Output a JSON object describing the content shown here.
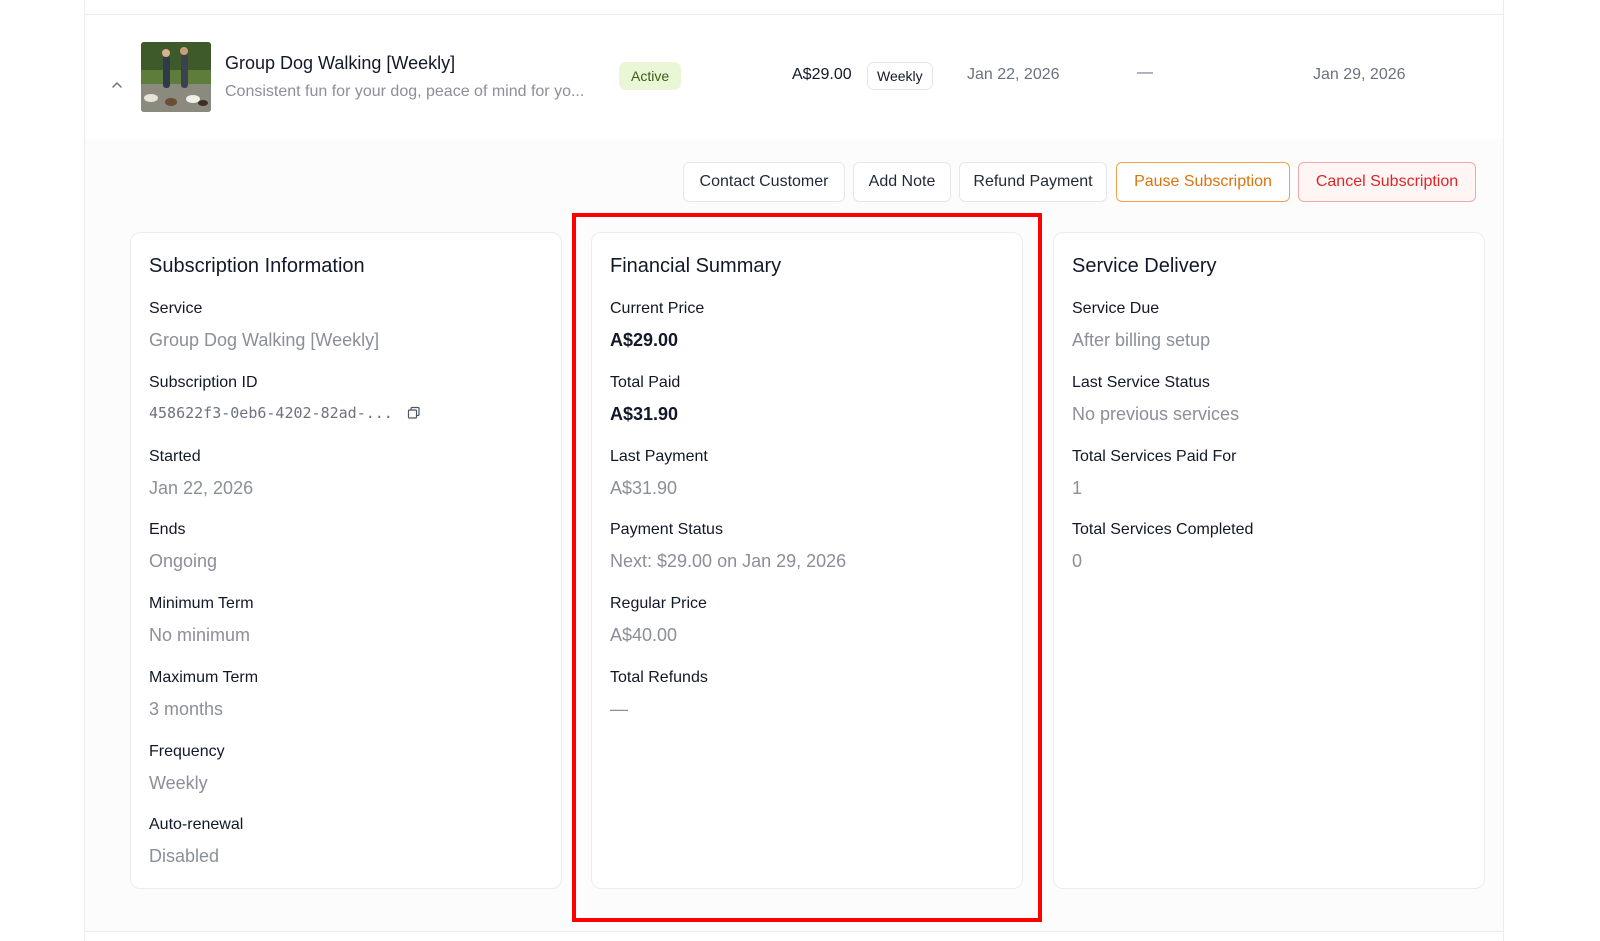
{
  "subscription_row": {
    "title": "Group Dog Walking [Weekly]",
    "description": "Consistent fun for your dog, peace of mind for yo...",
    "status": "Active",
    "price": "A$29.00",
    "frequency_badge": "Weekly",
    "start_date": "Jan 22, 2026",
    "end_date": "—",
    "next_date": "Jan 29, 2026"
  },
  "actions": {
    "contact": "Contact Customer",
    "note": "Add Note",
    "refund": "Refund Payment",
    "pause": "Pause Subscription",
    "cancel": "Cancel Subscription"
  },
  "subscription_info": {
    "title": "Subscription Information",
    "fields": [
      {
        "label": "Service",
        "value": "Group Dog Walking [Weekly]"
      },
      {
        "label": "Subscription ID",
        "value": "458622f3-0eb6-4202-82ad-..."
      },
      {
        "label": "Started",
        "value": "Jan 22, 2026"
      },
      {
        "label": "Ends",
        "value": "Ongoing"
      },
      {
        "label": "Minimum Term",
        "value": "No minimum"
      },
      {
        "label": "Maximum Term",
        "value": "3 months"
      },
      {
        "label": "Frequency",
        "value": "Weekly"
      },
      {
        "label": "Auto-renewal",
        "value": "Disabled"
      }
    ]
  },
  "financial_summary": {
    "title": "Financial Summary",
    "fields": [
      {
        "label": "Current Price",
        "value": "A$29.00"
      },
      {
        "label": "Total Paid",
        "value": "A$31.90"
      },
      {
        "label": "Last Payment",
        "value": "A$31.90"
      },
      {
        "label": "Payment Status",
        "value": "Next: $29.00 on Jan 29, 2026"
      },
      {
        "label": "Regular Price",
        "value": "A$40.00"
      },
      {
        "label": "Total Refunds",
        "value": "—"
      }
    ]
  },
  "service_delivery": {
    "title": "Service Delivery",
    "fields": [
      {
        "label": "Service Due",
        "value": "After billing setup"
      },
      {
        "label": "Last Service Status",
        "value": "No previous services"
      },
      {
        "label": "Total Services Paid For",
        "value": "1"
      },
      {
        "label": "Total Services Completed",
        "value": "0"
      }
    ]
  },
  "colors": {
    "active_badge_bg": "#e9f7d6",
    "pause_accent": "#d9730d",
    "cancel_accent": "#dc2626",
    "highlight": "#ff0000"
  },
  "icons": {
    "expand": "chevron-up-icon",
    "copy": "copy-icon"
  }
}
